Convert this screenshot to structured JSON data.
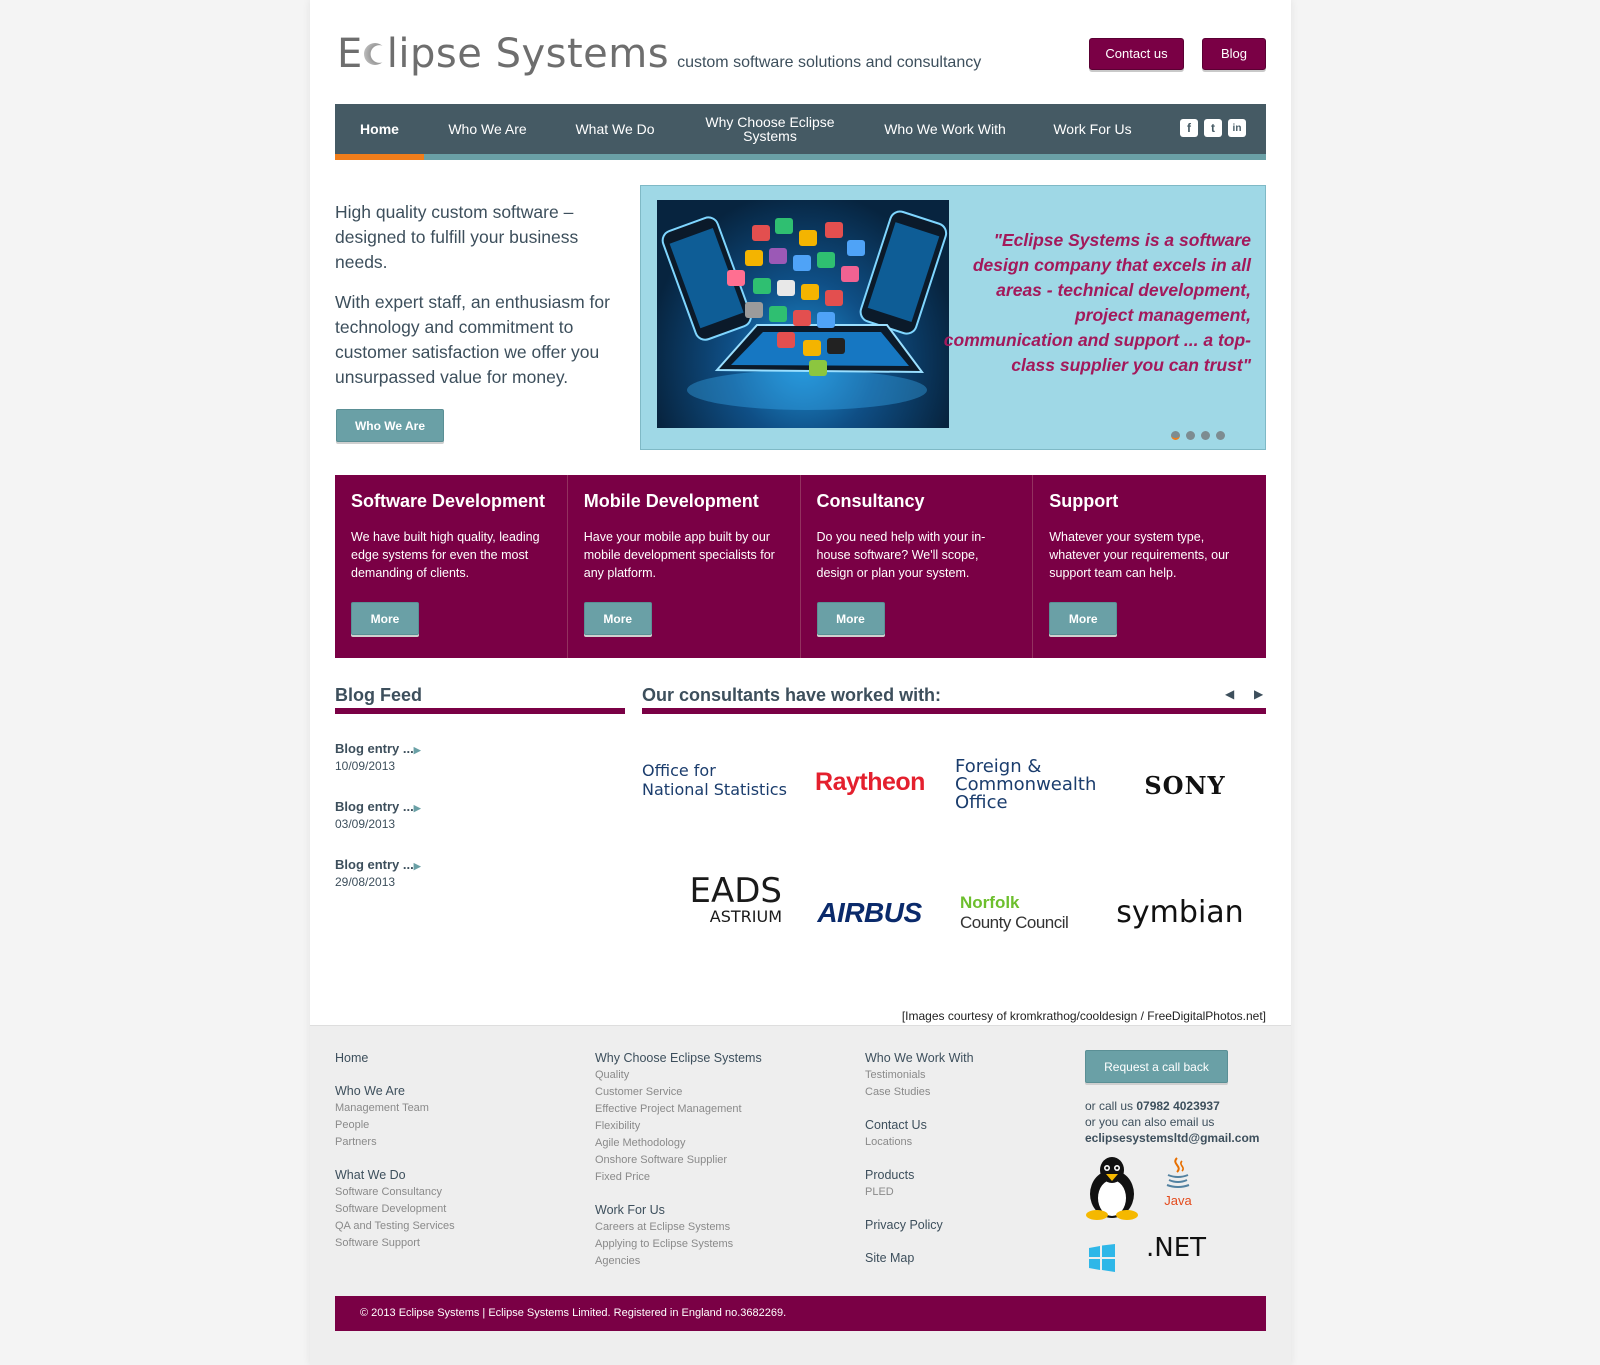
{
  "header": {
    "logo_main_a": "E",
    "logo_main_b": "lipse Systems",
    "logo_tagline": "custom software solutions and consultancy",
    "contact_btn": "Contact us",
    "blog_btn": "Blog"
  },
  "nav": {
    "items": [
      {
        "label": "Home"
      },
      {
        "label": "Who We Are"
      },
      {
        "label": "What We Do"
      },
      {
        "label": "Why Choose Eclipse Systems"
      },
      {
        "label": "Who We Work With"
      },
      {
        "label": "Work For Us"
      }
    ],
    "social": [
      "f",
      "t",
      "in"
    ]
  },
  "intro": {
    "p1": "High quality custom software – designed to fulfill your business needs.",
    "p2": "With expert staff, an enthusiasm for technology and commitment to customer satisfaction we offer you unsurpassed value for money.",
    "button": "Who We Are"
  },
  "hero": {
    "quote": "\"Eclipse Systems is a software design company that excels in all areas - technical development, project management, communication and support ... a top-class supplier you can trust\""
  },
  "services": [
    {
      "title": "Software Development",
      "text": "We have built high quality, leading edge systems for even the most demanding of clients.",
      "button": "More"
    },
    {
      "title": "Mobile Development",
      "text": "Have your mobile app built by our mobile development specialists for any platform.",
      "button": "More"
    },
    {
      "title": "Consultancy",
      "text": "Do you need help with your in-house software? We'll scope, design or plan your system.",
      "button": "More"
    },
    {
      "title": "Support",
      "text": "Whatever your system type, whatever your requirements, our support team can help.",
      "button": "More"
    }
  ],
  "blog": {
    "title": "Blog Feed",
    "entries": [
      {
        "title": "Blog entry ...",
        "date": "10/09/2013"
      },
      {
        "title": "Blog entry ...",
        "date": "03/09/2013"
      },
      {
        "title": "Blog entry ...",
        "date": "29/08/2013"
      }
    ]
  },
  "clients": {
    "title": "Our consultants have worked with:",
    "prev": "◀",
    "next": "▶",
    "logos": {
      "ons_a": "Office for",
      "ons_b": "National Statistics",
      "raytheon": "Raytheon",
      "fco": "Foreign & Commonwealth Office",
      "sony": "SONY",
      "eads_a": "EADS",
      "eads_b": "ASTRIUM",
      "airbus": "AIRBUS",
      "norfolk_a": "Norfolk",
      "norfolk_b": "County Council",
      "symbian": "symbian"
    }
  },
  "credit": "[Images courtesy of kromkrathog/cooldesign / FreeDigitalPhotos.net]",
  "footer": {
    "col1": {
      "home": "Home",
      "who": "Who We Are",
      "who_sub": [
        "Management Team",
        "People",
        "Partners"
      ],
      "what": "What We Do",
      "what_sub": [
        "Software Consultancy",
        "Software Development",
        "QA and Testing Services",
        "Software Support"
      ]
    },
    "col2": {
      "why": "Why Choose Eclipse Systems",
      "why_sub": [
        "Quality",
        "Customer Service",
        "Effective Project Management",
        "Flexibility",
        "Agile Methodology",
        "Onshore Software Supplier",
        "Fixed Price"
      ],
      "work": "Work For Us",
      "work_sub": [
        "Careers at Eclipse Systems",
        "Applying to Eclipse Systems",
        "Agencies"
      ]
    },
    "col3": {
      "whowith": "Who We Work With",
      "whowith_sub": [
        "Testimonials",
        "Case Studies"
      ],
      "contact": "Contact Us",
      "contact_sub": [
        "Locations"
      ],
      "products": "Products",
      "products_sub": [
        "PLED"
      ],
      "privacy": "Privacy Policy",
      "sitemap": "Site Map"
    },
    "callback_btn": "Request a call back",
    "call_prefix": "or call us ",
    "phone": "07982 4023937",
    "email_prefix": "or you can also email us",
    "email": "eclipsesystemsltd@gmail.com",
    "java": "Java",
    "dotnet": ".NET"
  },
  "copyright": "© 2013 Eclipse Systems  |  Eclipse Systems Limited. Registered in England no.3682269."
}
